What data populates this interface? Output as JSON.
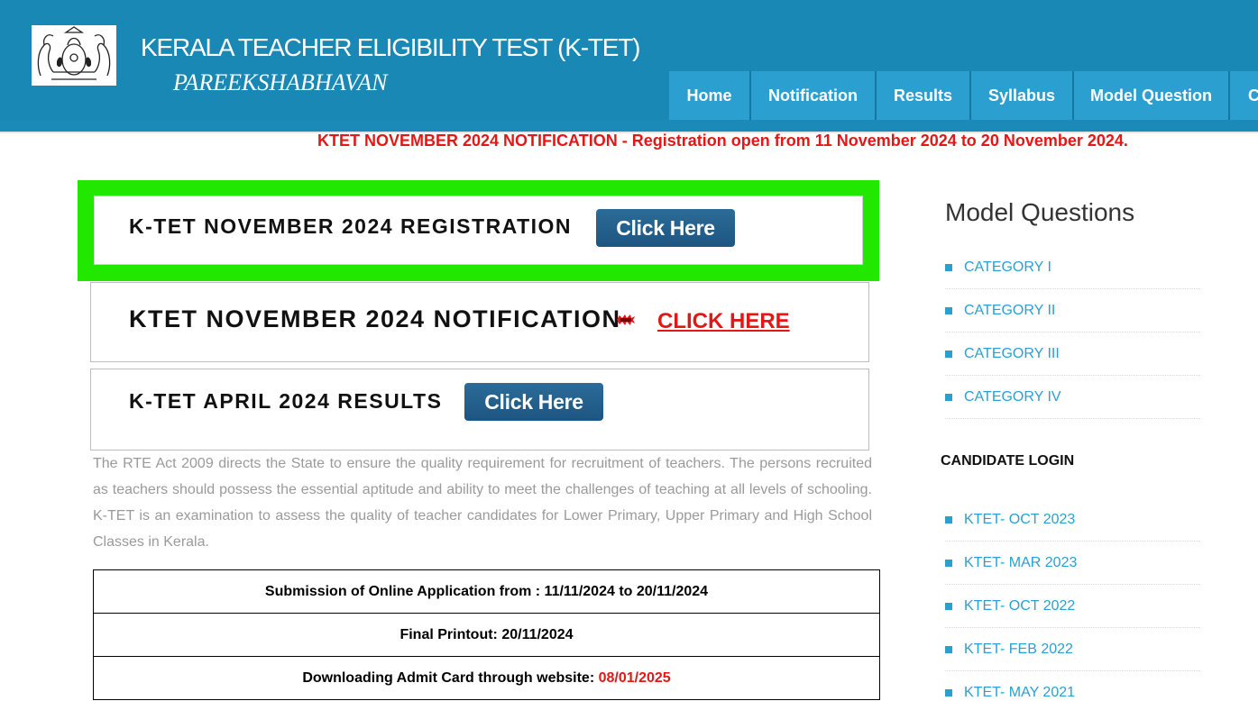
{
  "header": {
    "title": "KERALA TEACHER ELIGIBILITY TEST (K-TET)",
    "subtitle": "PAREEKSHABHAVAN",
    "emblem_icon": "kerala-state-emblem",
    "colors": {
      "header_bg": "#1a88b5",
      "nav_bg": "#2a9fd0"
    }
  },
  "nav": {
    "items": [
      "Home",
      "Notification",
      "Results",
      "Syllabus",
      "Model Question",
      "C"
    ]
  },
  "announcement": "KTET NOVEMBER 2024 NOTIFICATION - Registration open from 11 November 2024 to 20 November 2024.",
  "main": {
    "registration": {
      "label": "K-TET NOVEMBER 2024 REGISTRATION",
      "button": "Click Here",
      "highlight_color": "#22e800"
    },
    "notification": {
      "label": "KTET NOVEMBER 2024 NOTIFICATION",
      "new_icon": "new-badge-icon",
      "link": "CLICK HERE"
    },
    "results": {
      "label": "K-TET APRIL 2024 RESULTS",
      "button": "Click Here"
    },
    "intro": "The RTE Act 2009 directs the State to ensure the quality requirement for recruitment of teachers. The persons recruited as teachers should possess the essential aptitude and ability to meet the challenges of teaching at all levels of schooling. K-TET is an examination to assess the quality of teacher candidates for Lower Primary, Upper Primary and High School Classes in Kerala.",
    "schedule": [
      {
        "text": "Submission of Online Application from : 11/11/2024 to 20/11/2024",
        "value": ""
      },
      {
        "text": "Final Printout: 20/11/2024",
        "value": ""
      },
      {
        "text": "Downloading Admit Card through website: ",
        "value": "08/01/2025"
      }
    ]
  },
  "sidebar": {
    "model_title": "Model Questions",
    "categories": [
      "CATEGORY I",
      "CATEGORY II",
      "CATEGORY III",
      "CATEGORY IV"
    ],
    "login_title": "CANDIDATE LOGIN",
    "logins": [
      "KTET- OCT 2023",
      "KTET- MAR 2023",
      "KTET- OCT 2022",
      "KTET- FEB 2022",
      "KTET- MAY 2021"
    ]
  }
}
